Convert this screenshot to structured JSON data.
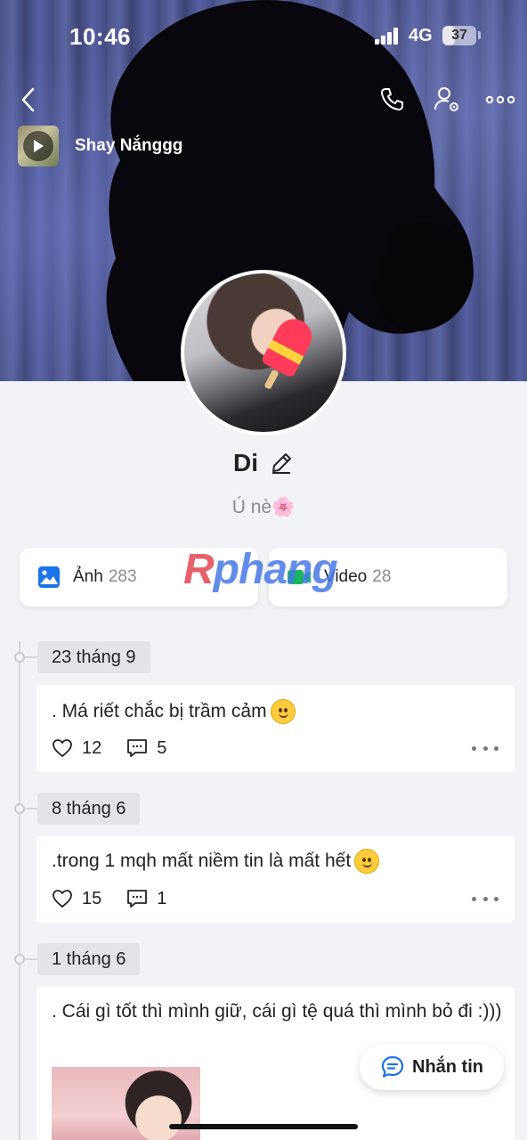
{
  "status_bar": {
    "time": "10:46",
    "network": "4G",
    "battery": "37",
    "battery_level": 0.37
  },
  "music": {
    "title": "Shay Nắnggg"
  },
  "profile": {
    "name": "Di",
    "bio": "Ú nè🌸"
  },
  "media": {
    "photos": {
      "label": "Ảnh",
      "count": "283"
    },
    "videos": {
      "label": "Video",
      "count": "28"
    }
  },
  "watermark": {
    "text_r": "R",
    "text_rest": "phang"
  },
  "posts": [
    {
      "date": "23 tháng 9",
      "text": ". Má riết chắc bị trầm cảm",
      "likes": "12",
      "comments": "5"
    },
    {
      "date": "8 tháng 6",
      "text": ".trong 1 mqh mất niềm tin là mất hết",
      "likes": "15",
      "comments": "1"
    },
    {
      "date": "1 tháng 6",
      "text": ". Cái gì tốt thì mình giữ, cái gì tệ quá thì mình bỏ đi :)))"
    }
  ],
  "message_button": {
    "label": "Nhắn tin"
  },
  "colors": {
    "accent_blue": "#1a73e8",
    "video_green": "#18b65e",
    "cover": "#4a5286"
  },
  "icons": [
    "back-icon",
    "call-icon",
    "profile-settings-icon",
    "more-icon",
    "play-icon",
    "edit-icon",
    "photos-icon",
    "video-icon",
    "heart-icon",
    "comment-icon",
    "message-icon"
  ]
}
